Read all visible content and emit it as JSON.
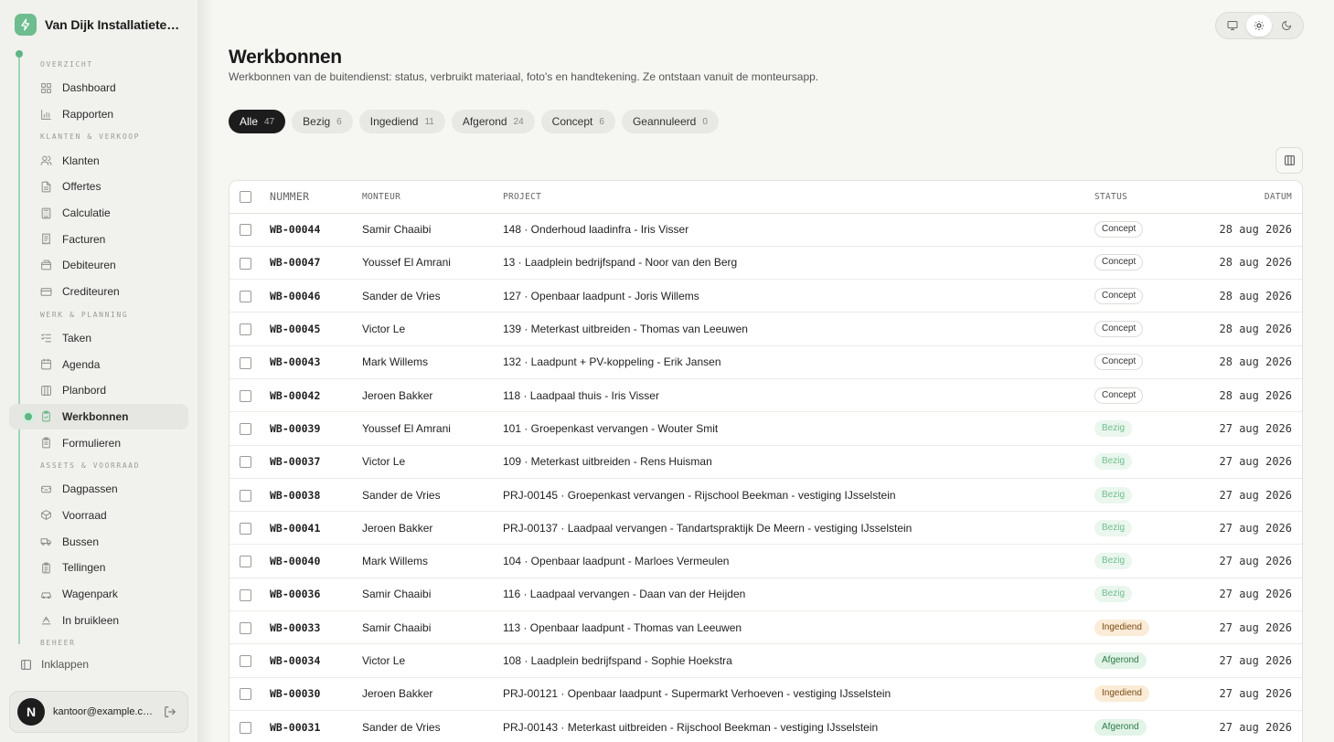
{
  "brand": {
    "name": "Van Dijk Installatietechniek",
    "logo_icon": "bolt-icon",
    "accent": "#5fb583"
  },
  "sidebar": {
    "sections": [
      {
        "label": "OVERZICHT",
        "items": [
          {
            "label": "Dashboard",
            "icon": "grid-icon"
          },
          {
            "label": "Rapporten",
            "icon": "bar-chart-icon"
          }
        ]
      },
      {
        "label": "KLANTEN & VERKOOP",
        "items": [
          {
            "label": "Klanten",
            "icon": "users-icon"
          },
          {
            "label": "Offertes",
            "icon": "document-icon"
          },
          {
            "label": "Calculatie",
            "icon": "calculator-icon"
          },
          {
            "label": "Facturen",
            "icon": "invoice-icon"
          },
          {
            "label": "Debiteuren",
            "icon": "wallet-icon"
          },
          {
            "label": "Crediteuren",
            "icon": "card-icon"
          }
        ]
      },
      {
        "label": "WERK & PLANNING",
        "items": [
          {
            "label": "Taken",
            "icon": "checklist-icon"
          },
          {
            "label": "Agenda",
            "icon": "calendar-icon"
          },
          {
            "label": "Planbord",
            "icon": "board-icon"
          },
          {
            "label": "Werkbonnen",
            "icon": "clipboard-icon",
            "active": true
          },
          {
            "label": "Formulieren",
            "icon": "form-icon"
          }
        ]
      },
      {
        "label": "ASSETS & VOORRAAD",
        "items": [
          {
            "label": "Dagpassen",
            "icon": "ticket-icon"
          },
          {
            "label": "Voorraad",
            "icon": "box-icon"
          },
          {
            "label": "Bussen",
            "icon": "van-icon"
          },
          {
            "label": "Tellingen",
            "icon": "clipboard-list-icon"
          },
          {
            "label": "Wagenpark",
            "icon": "car-icon"
          },
          {
            "label": "In bruikleen",
            "icon": "handoff-icon"
          }
        ]
      },
      {
        "label": "BEHEER",
        "items": []
      }
    ],
    "collapse_label": "Inklappen",
    "user": {
      "initial": "N",
      "email": "kantoor@example.com"
    }
  },
  "theme_switch": {
    "options": [
      "monitor-icon",
      "sun-icon",
      "moon-icon"
    ],
    "selected": "sun-icon"
  },
  "header": {
    "title": "Werkbonnen",
    "subtitle": "Werkbonnen van de buitendienst: status, verbruikt materiaal, foto's en handtekening. Ze ontstaan vanuit de monteursapp."
  },
  "tabs": [
    {
      "label": "Alle",
      "count": "47",
      "active": true
    },
    {
      "label": "Bezig",
      "count": "6"
    },
    {
      "label": "Ingediend",
      "count": "11"
    },
    {
      "label": "Afgerond",
      "count": "24"
    },
    {
      "label": "Concept",
      "count": "6"
    },
    {
      "label": "Geannuleerd",
      "count": "0"
    }
  ],
  "table": {
    "columns": {
      "nummer": "NUMMER",
      "monteur": "MONTEUR",
      "project": "PROJECT",
      "status": "STATUS",
      "datum": "DATUM"
    },
    "rows": [
      {
        "nummer": "WB-00044",
        "monteur": "Samir Chaaibi",
        "project": "148 · Onderhoud laadinfra - Iris Visser",
        "status": "Concept",
        "datum": "28 aug 2026"
      },
      {
        "nummer": "WB-00047",
        "monteur": "Youssef El Amrani",
        "project": "13 · Laadplein bedrijfspand - Noor van den Berg",
        "status": "Concept",
        "datum": "28 aug 2026"
      },
      {
        "nummer": "WB-00046",
        "monteur": "Sander de Vries",
        "project": "127 · Openbaar laadpunt - Joris Willems",
        "status": "Concept",
        "datum": "28 aug 2026"
      },
      {
        "nummer": "WB-00045",
        "monteur": "Victor Le",
        "project": "139 · Meterkast uitbreiden - Thomas van Leeuwen",
        "status": "Concept",
        "datum": "28 aug 2026"
      },
      {
        "nummer": "WB-00043",
        "monteur": "Mark Willems",
        "project": "132 · Laadpunt + PV-koppeling - Erik Jansen",
        "status": "Concept",
        "datum": "28 aug 2026"
      },
      {
        "nummer": "WB-00042",
        "monteur": "Jeroen Bakker",
        "project": "118 · Laadpaal thuis - Iris Visser",
        "status": "Concept",
        "datum": "28 aug 2026"
      },
      {
        "nummer": "WB-00039",
        "monteur": "Youssef El Amrani",
        "project": "101 · Groepenkast vervangen - Wouter Smit",
        "status": "Bezig",
        "datum": "27 aug 2026"
      },
      {
        "nummer": "WB-00037",
        "monteur": "Victor Le",
        "project": "109 · Meterkast uitbreiden - Rens Huisman",
        "status": "Bezig",
        "datum": "27 aug 2026"
      },
      {
        "nummer": "WB-00038",
        "monteur": "Sander de Vries",
        "project": "PRJ-00145 · Groepenkast vervangen - Rijschool Beekman - vestiging IJsselstein",
        "status": "Bezig",
        "datum": "27 aug 2026"
      },
      {
        "nummer": "WB-00041",
        "monteur": "Jeroen Bakker",
        "project": "PRJ-00137 · Laadpaal vervangen - Tandartspraktijk De Meern - vestiging IJsselstein",
        "status": "Bezig",
        "datum": "27 aug 2026"
      },
      {
        "nummer": "WB-00040",
        "monteur": "Mark Willems",
        "project": "104 · Openbaar laadpunt - Marloes Vermeulen",
        "status": "Bezig",
        "datum": "27 aug 2026"
      },
      {
        "nummer": "WB-00036",
        "monteur": "Samir Chaaibi",
        "project": "116 · Laadpaal vervangen - Daan van der Heijden",
        "status": "Bezig",
        "datum": "27 aug 2026"
      },
      {
        "nummer": "WB-00033",
        "monteur": "Samir Chaaibi",
        "project": "113 · Openbaar laadpunt - Thomas van Leeuwen",
        "status": "Ingediend",
        "datum": "27 aug 2026"
      },
      {
        "nummer": "WB-00034",
        "monteur": "Victor Le",
        "project": "108 · Laadplein bedrijfspand - Sophie Hoekstra",
        "status": "Afgerond",
        "datum": "27 aug 2026"
      },
      {
        "nummer": "WB-00030",
        "monteur": "Jeroen Bakker",
        "project": "PRJ-00121 · Openbaar laadpunt - Supermarkt Verhoeven - vestiging IJsselstein",
        "status": "Ingediend",
        "datum": "27 aug 2026"
      },
      {
        "nummer": "WB-00031",
        "monteur": "Sander de Vries",
        "project": "PRJ-00143 · Meterkast uitbreiden - Rijschool Beekman - vestiging IJsselstein",
        "status": "Afgerond",
        "datum": "27 aug 2026"
      }
    ]
  }
}
